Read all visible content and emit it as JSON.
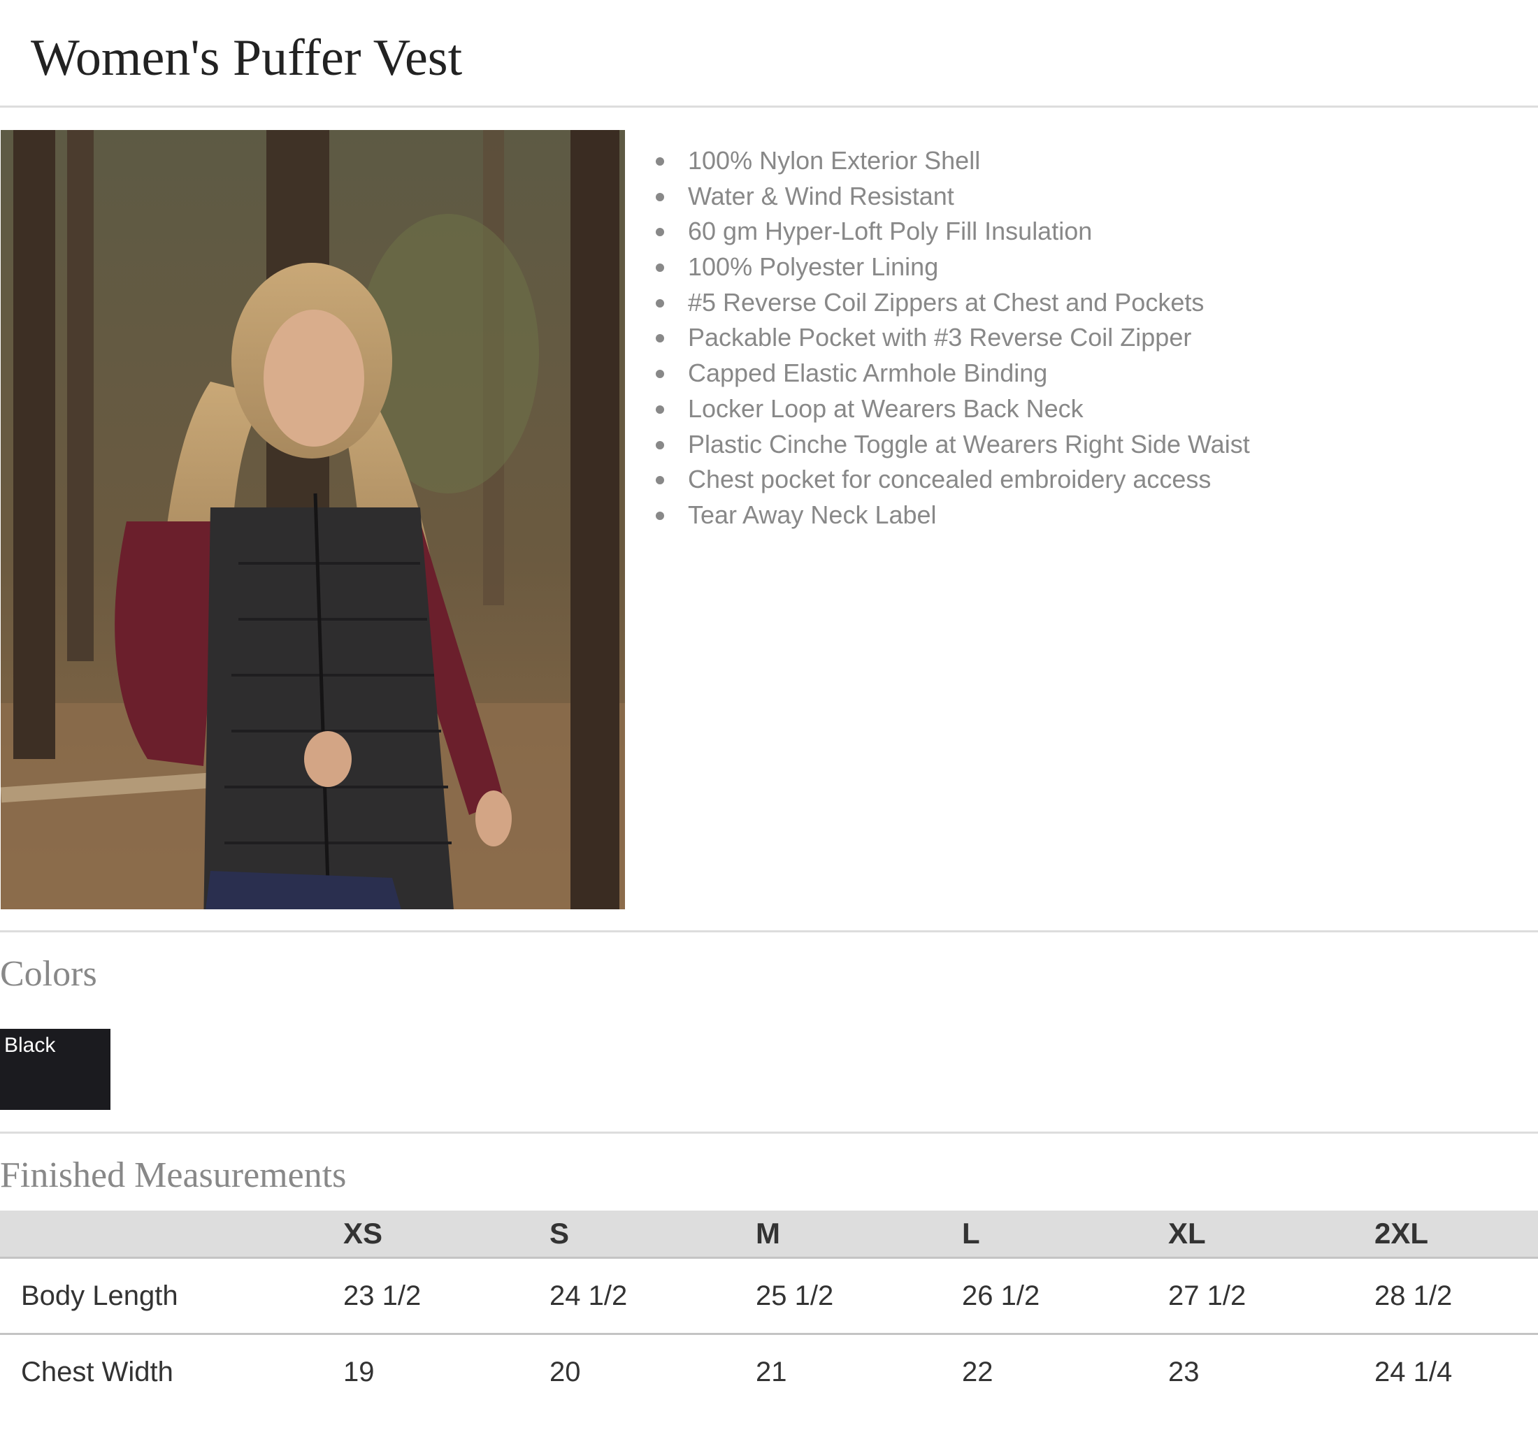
{
  "product": {
    "title": "Women's Puffer Vest"
  },
  "features": [
    "100% Nylon Exterior Shell",
    "Water & Wind Resistant",
    "60 gm Hyper-Loft Poly Fill Insulation",
    "100% Polyester Lining",
    "#5 Reverse Coil Zippers at Chest and Pockets",
    "Packable Pocket with #3 Reverse Coil Zipper",
    "Capped Elastic Armhole Binding",
    "Locker Loop at Wearers Back Neck",
    "Plastic Cinche Toggle at Wearers Right Side Waist",
    "Chest pocket for concealed embroidery access",
    "Tear Away Neck Label"
  ],
  "colors": {
    "heading": "Colors",
    "swatches": [
      {
        "name": "Black",
        "hex": "#1b1b1f"
      }
    ]
  },
  "measurements": {
    "heading": "Finished Measurements",
    "sizes": [
      "XS",
      "S",
      "M",
      "L",
      "XL",
      "2XL"
    ],
    "rows": [
      {
        "label": "Body Length",
        "values": [
          "23 1/2",
          "24 1/2",
          "25 1/2",
          "26 1/2",
          "27 1/2",
          "28 1/2"
        ]
      },
      {
        "label": "Chest Width",
        "values": [
          "19",
          "20",
          "21",
          "22",
          "23",
          "24 1/4"
        ]
      }
    ]
  }
}
